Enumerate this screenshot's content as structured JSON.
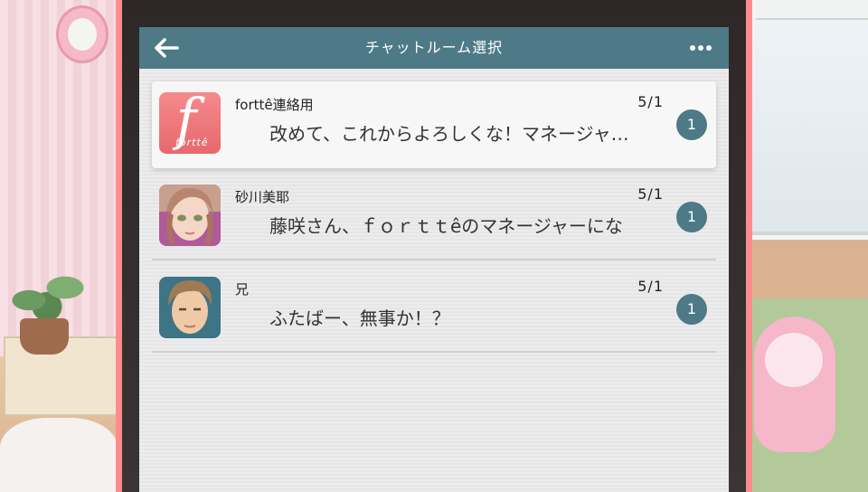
{
  "header": {
    "title": "チャットルーム選択"
  },
  "chats": [
    {
      "name": "forttê連絡用",
      "date": "5/1",
      "preview": "改めて、これからよろしくな！マネージャ…",
      "unread": "1",
      "logo_letter": "f",
      "logo_word": "forttê"
    },
    {
      "name": "砂川美耶",
      "date": "5/1",
      "preview": "藤咲さん、ｆｏｒｔｔêのマネージャーにな",
      "unread": "1"
    },
    {
      "name": "兄",
      "date": "5/1",
      "preview": "ふたばー、無事か！？",
      "unread": "1"
    }
  ],
  "colors": {
    "header": "#4d7a86",
    "badge": "#4d7a86",
    "device_frame": "#ff8c8c",
    "logo": "#e7686c"
  },
  "icons": {
    "back": "arrow-left-icon",
    "more": "more-dots-icon"
  }
}
